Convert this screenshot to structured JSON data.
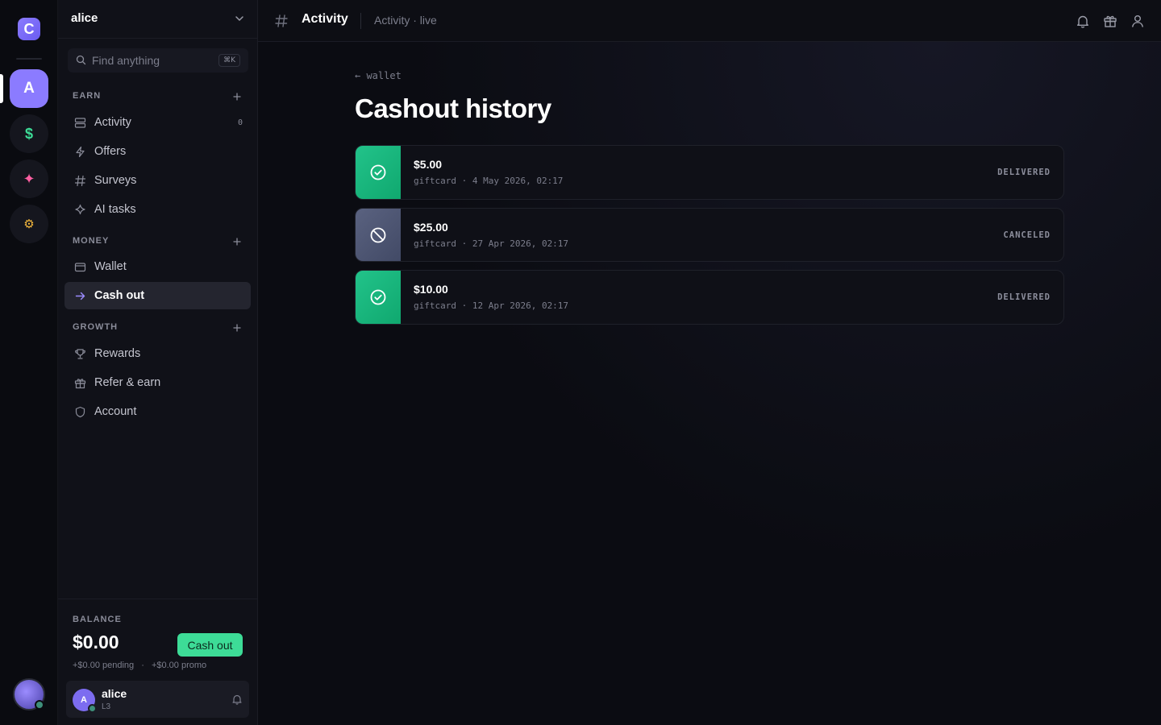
{
  "rail": {
    "logo": "C",
    "items": [
      {
        "label": "A",
        "color": "#ffffff",
        "active": true
      },
      {
        "label": "$",
        "color": "#3ddc97"
      },
      {
        "label": "✦",
        "color": "#ff5fa2"
      },
      {
        "label": "⚙",
        "color": "#f5b83d"
      }
    ]
  },
  "sidebar": {
    "workspace": "alice",
    "search_placeholder": "Find anything",
    "search_shortcut": "⌘K",
    "sections": [
      {
        "label": "EARN",
        "items": [
          {
            "label": "Activity",
            "icon": "stack-icon",
            "count": "0"
          },
          {
            "label": "Offers",
            "icon": "bolt-icon"
          },
          {
            "label": "Surveys",
            "icon": "hash-icon"
          },
          {
            "label": "AI tasks",
            "icon": "sparkle-icon"
          }
        ]
      },
      {
        "label": "MONEY",
        "items": [
          {
            "label": "Wallet",
            "icon": "wallet-icon"
          },
          {
            "label": "Cash out",
            "icon": "arrow-right-icon",
            "active": true
          }
        ]
      },
      {
        "label": "GROWTH",
        "items": [
          {
            "label": "Rewards",
            "icon": "trophy-icon"
          },
          {
            "label": "Refer & earn",
            "icon": "gift-icon"
          },
          {
            "label": "Account",
            "icon": "shield-icon"
          }
        ]
      }
    ],
    "balance": {
      "label": "BALANCE",
      "amount": "$0.00",
      "cashout_label": "Cash out",
      "pending": "+$0.00 pending",
      "separator": "·",
      "promo": "+$0.00 promo"
    },
    "user": {
      "initial": "A",
      "name": "alice",
      "level": "L3"
    }
  },
  "topbar": {
    "title": "Activity",
    "subtitle": "Activity · live"
  },
  "main": {
    "back_link": "← wallet",
    "title": "Cashout history",
    "rows": [
      {
        "amount": "$5.00",
        "meta": "giftcard · 4 May 2026, 02:17",
        "status": "DELIVERED"
      },
      {
        "amount": "$25.00",
        "meta": "giftcard · 27 Apr 2026, 02:17",
        "status": "CANCELED"
      },
      {
        "amount": "$10.00",
        "meta": "giftcard · 12 Apr 2026, 02:17",
        "status": "DELIVERED"
      }
    ]
  },
  "colors": {
    "accent": "#8b7bff",
    "success": "#3ddc97",
    "canceled": "#5a6280"
  }
}
